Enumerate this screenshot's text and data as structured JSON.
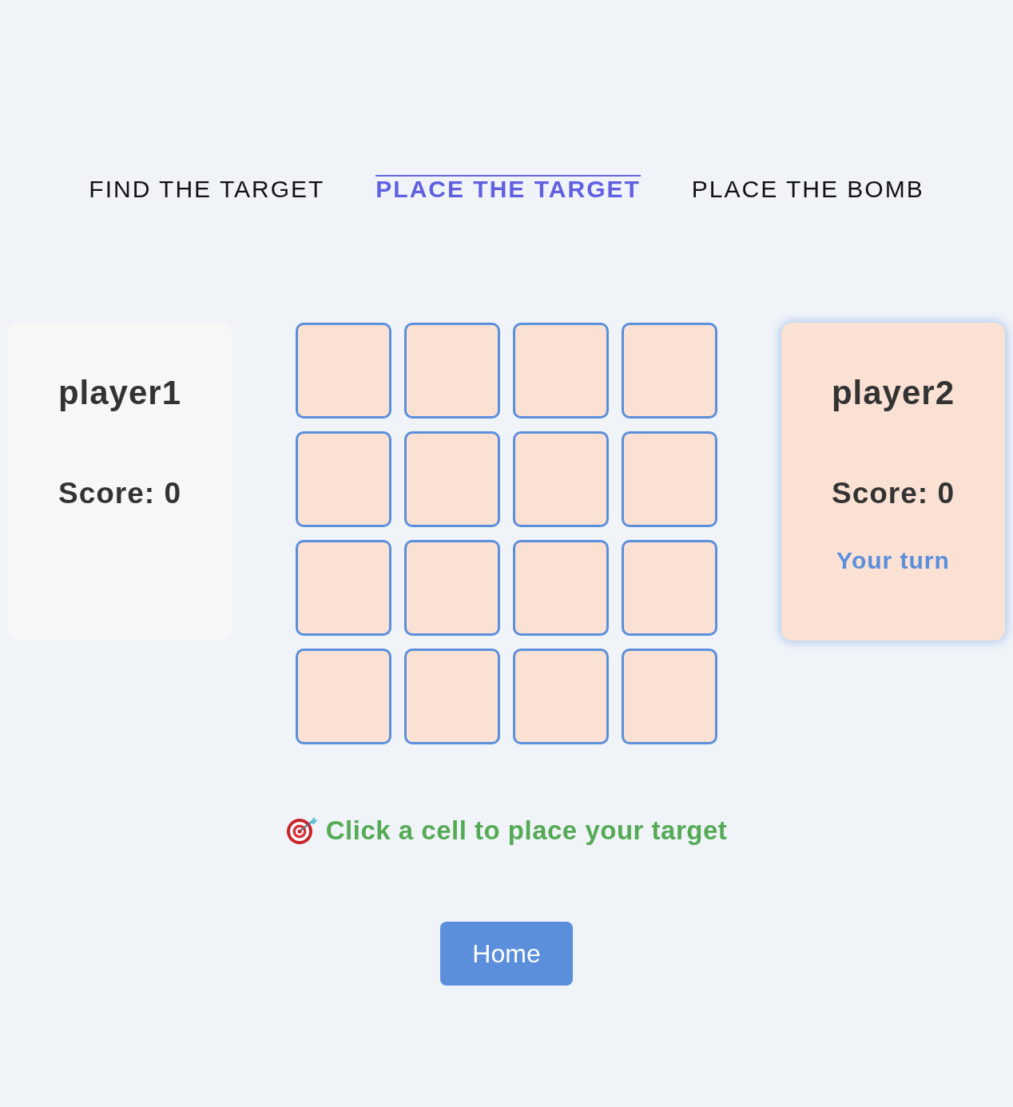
{
  "tabs": [
    {
      "label": "FIND THE TARGET",
      "selected": false
    },
    {
      "label": "PLACE THE TARGET",
      "selected": true
    },
    {
      "label": "PLACE THE BOMB",
      "selected": false
    }
  ],
  "players": [
    {
      "name": "player1",
      "score": "Score: 0",
      "active": false
    },
    {
      "name": "player2",
      "score": "Score: 0",
      "active": true,
      "status": "Your turn"
    }
  ],
  "board": {
    "rows": [
      [
        {
          "kind": "empty"
        },
        {
          "kind": "empty"
        },
        {
          "kind": "empty"
        },
        {
          "kind": "empty"
        }
      ],
      [
        {
          "kind": "empty"
        },
        {
          "kind": "empty"
        },
        {
          "kind": "empty"
        },
        {
          "kind": "empty"
        }
      ],
      [
        {
          "kind": "empty"
        },
        {
          "kind": "empty"
        },
        {
          "kind": "empty"
        },
        {
          "kind": "empty"
        }
      ],
      [
        {
          "kind": "empty"
        },
        {
          "kind": "empty"
        },
        {
          "kind": "empty"
        },
        {
          "kind": "empty"
        }
      ]
    ]
  },
  "message": {
    "text": "Click a cell to place your target"
  },
  "home_button": {
    "label": "Home"
  }
}
